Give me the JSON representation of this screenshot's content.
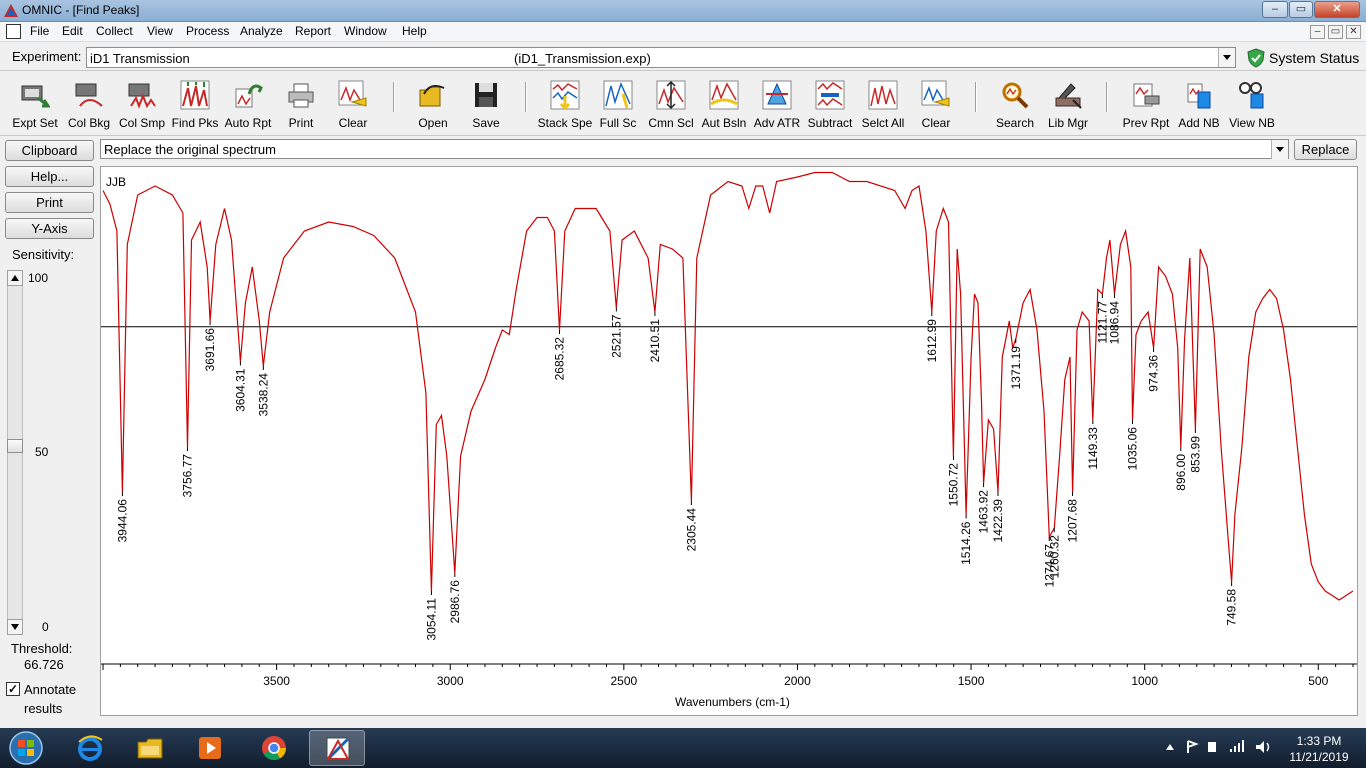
{
  "window": {
    "title": "OMNIC - [Find Peaks]",
    "minimize": "–",
    "maximize": "▭",
    "close": "✕"
  },
  "menu": [
    "File",
    "Edit",
    "Collect",
    "View",
    "Process",
    "Analyze",
    "Report",
    "Window",
    "Help"
  ],
  "experiment": {
    "label": "Experiment:",
    "value": "iD1 Transmission",
    "file": "(iD1_Transmission.exp)"
  },
  "system_status": "System Status",
  "toolbar": [
    {
      "label": "Expt Set",
      "icon": "expt-set-icon"
    },
    {
      "label": "Col Bkg",
      "icon": "collect-background-icon"
    },
    {
      "label": "Col Smp",
      "icon": "collect-sample-icon"
    },
    {
      "label": "Find Pks",
      "icon": "find-peaks-icon"
    },
    {
      "label": "Auto Rpt",
      "icon": "auto-report-icon"
    },
    {
      "label": "Print",
      "icon": "printer-icon"
    },
    {
      "label": "Clear",
      "icon": "clear-icon"
    },
    {
      "label": "Open",
      "icon": "open-folder-icon"
    },
    {
      "label": "Save",
      "icon": "floppy-disk-icon"
    },
    {
      "label": "Stack Spe",
      "icon": "stack-spectra-icon"
    },
    {
      "label": "Full Sc",
      "icon": "full-scale-icon"
    },
    {
      "label": "Cmn Scl",
      "icon": "common-scale-icon"
    },
    {
      "label": "Aut Bsln",
      "icon": "auto-baseline-icon"
    },
    {
      "label": "Adv ATR",
      "icon": "advanced-atr-icon"
    },
    {
      "label": "Subtract",
      "icon": "subtract-icon"
    },
    {
      "label": "Selct All",
      "icon": "select-all-icon"
    },
    {
      "label": "Clear",
      "icon": "clear-icon"
    },
    {
      "label": "Search",
      "icon": "magnifier-search-icon"
    },
    {
      "label": "Lib Mgr",
      "icon": "library-manager-icon"
    },
    {
      "label": "Prev Rpt",
      "icon": "preview-report-icon"
    },
    {
      "label": "Add NB",
      "icon": "add-notebook-icon"
    },
    {
      "label": "View NB",
      "icon": "view-notebook-icon"
    }
  ],
  "command": {
    "value": "Replace the original spectrum",
    "replace": "Replace"
  },
  "side": {
    "buttons": [
      "Clipboard",
      "Help...",
      "Print",
      "Y-Axis"
    ],
    "sensitivity_label": "Sensitivity:",
    "sensitivity_ticks": [
      "100",
      "50",
      "0"
    ],
    "sensitivity_value": 50,
    "threshold_label": "Threshold:",
    "threshold_value": "66.726",
    "annotate_checked": true,
    "annotate_line1": "Annotate",
    "annotate_line2": "results"
  },
  "chart_data": {
    "type": "line",
    "spectrum_label": "JJB",
    "xlabel": "Wavenumbers (cm-1)",
    "xlim": [
      4000,
      400
    ],
    "xticks": [
      3500,
      3000,
      2500,
      2000,
      1500,
      1000,
      500
    ],
    "threshold_percent": 66.726,
    "series": [
      {
        "color": "#cc0000",
        "points": [
          [
            4000,
            97
          ],
          [
            3980,
            94
          ],
          [
            3960,
            88
          ],
          [
            3944.06,
            30
          ],
          [
            3930,
            85
          ],
          [
            3900,
            96
          ],
          [
            3850,
            98
          ],
          [
            3800,
            96
          ],
          [
            3770,
            92
          ],
          [
            3756.77,
            40
          ],
          [
            3745,
            86
          ],
          [
            3720,
            90
          ],
          [
            3700,
            80
          ],
          [
            3691.66,
            68
          ],
          [
            3675,
            85
          ],
          [
            3650,
            93
          ],
          [
            3630,
            86
          ],
          [
            3604.31,
            59
          ],
          [
            3590,
            72
          ],
          [
            3570,
            80
          ],
          [
            3550,
            68
          ],
          [
            3538.24,
            58
          ],
          [
            3520,
            70
          ],
          [
            3480,
            82
          ],
          [
            3420,
            88
          ],
          [
            3350,
            90
          ],
          [
            3280,
            89
          ],
          [
            3220,
            87
          ],
          [
            3160,
            82
          ],
          [
            3100,
            70
          ],
          [
            3070,
            52
          ],
          [
            3054.11,
            8
          ],
          [
            3040,
            45
          ],
          [
            3025,
            47
          ],
          [
            3010,
            38
          ],
          [
            2986.76,
            12
          ],
          [
            2970,
            38
          ],
          [
            2940,
            48
          ],
          [
            2900,
            55
          ],
          [
            2870,
            62
          ],
          [
            2850,
            66
          ],
          [
            2830,
            65
          ],
          [
            2810,
            75
          ],
          [
            2780,
            88
          ],
          [
            2750,
            91
          ],
          [
            2720,
            91
          ],
          [
            2700,
            88
          ],
          [
            2685.32,
            66
          ],
          [
            2670,
            88
          ],
          [
            2640,
            93
          ],
          [
            2580,
            93
          ],
          [
            2540,
            88
          ],
          [
            2521.57,
            71
          ],
          [
            2505,
            86
          ],
          [
            2470,
            88
          ],
          [
            2430,
            82
          ],
          [
            2410.51,
            70
          ],
          [
            2395,
            85
          ],
          [
            2360,
            84
          ],
          [
            2330,
            82
          ],
          [
            2305.44,
            28
          ],
          [
            2290,
            82
          ],
          [
            2250,
            96
          ],
          [
            2200,
            99
          ],
          [
            2160,
            98
          ],
          [
            2140,
            93
          ],
          [
            2120,
            98
          ],
          [
            2100,
            98
          ],
          [
            2080,
            92
          ],
          [
            2060,
            99
          ],
          [
            2000,
            100
          ],
          [
            1950,
            101
          ],
          [
            1900,
            101
          ],
          [
            1850,
            99
          ],
          [
            1800,
            99
          ],
          [
            1720,
            97
          ],
          [
            1690,
            93
          ],
          [
            1670,
            97
          ],
          [
            1650,
            98
          ],
          [
            1630,
            88
          ],
          [
            1612.99,
            70
          ],
          [
            1600,
            88
          ],
          [
            1580,
            93
          ],
          [
            1565,
            90
          ],
          [
            1550.72,
            38
          ],
          [
            1540,
            84
          ],
          [
            1530,
            74
          ],
          [
            1514.26,
            25
          ],
          [
            1500,
            60
          ],
          [
            1490,
            74
          ],
          [
            1480,
            72
          ],
          [
            1470,
            50
          ],
          [
            1463.92,
            32
          ],
          [
            1450,
            46
          ],
          [
            1435,
            44
          ],
          [
            1422.39,
            30
          ],
          [
            1410,
            60
          ],
          [
            1390,
            68
          ],
          [
            1380,
            62
          ],
          [
            1371.19,
            64
          ],
          [
            1350,
            72
          ],
          [
            1330,
            75
          ],
          [
            1310,
            66
          ],
          [
            1290,
            48
          ],
          [
            1274.67,
            20
          ],
          [
            1260.32,
            22
          ],
          [
            1245,
            38
          ],
          [
            1230,
            55
          ],
          [
            1215,
            60
          ],
          [
            1207.68,
            30
          ],
          [
            1195,
            66
          ],
          [
            1180,
            70
          ],
          [
            1160,
            68
          ],
          [
            1149.33,
            46
          ],
          [
            1135,
            75
          ],
          [
            1121.77,
            74
          ],
          [
            1110,
            82
          ],
          [
            1100,
            86
          ],
          [
            1086.94,
            74
          ],
          [
            1070,
            85
          ],
          [
            1055,
            88
          ],
          [
            1040,
            80
          ],
          [
            1035.06,
            46
          ],
          [
            1025,
            65
          ],
          [
            1010,
            68
          ],
          [
            990,
            70
          ],
          [
            974.36,
            62
          ],
          [
            960,
            80
          ],
          [
            940,
            78
          ],
          [
            920,
            74
          ],
          [
            905,
            62
          ],
          [
            896.0,
            40
          ],
          [
            885,
            64
          ],
          [
            870,
            82
          ],
          [
            853.99,
            44
          ],
          [
            840,
            84
          ],
          [
            820,
            80
          ],
          [
            800,
            65
          ],
          [
            780,
            40
          ],
          [
            760,
            20
          ],
          [
            749.58,
            10
          ],
          [
            740,
            25
          ],
          [
            720,
            40
          ],
          [
            700,
            60
          ],
          [
            680,
            70
          ],
          [
            660,
            73
          ],
          [
            640,
            75
          ],
          [
            620,
            73
          ],
          [
            600,
            66
          ],
          [
            580,
            55
          ],
          [
            560,
            40
          ],
          [
            540,
            25
          ],
          [
            520,
            14
          ],
          [
            500,
            10
          ],
          [
            480,
            8
          ],
          [
            460,
            7
          ],
          [
            440,
            6
          ],
          [
            420,
            7
          ],
          [
            400,
            8
          ]
        ]
      }
    ],
    "peaks": [
      {
        "x": 3944.06,
        "label": "3944.06"
      },
      {
        "x": 3756.77,
        "label": "3756.77"
      },
      {
        "x": 3691.66,
        "label": "3691.66"
      },
      {
        "x": 3604.31,
        "label": "3604.31"
      },
      {
        "x": 3538.24,
        "label": "3538.24"
      },
      {
        "x": 3054.11,
        "label": "3054.11"
      },
      {
        "x": 2986.76,
        "label": "2986.76"
      },
      {
        "x": 2685.32,
        "label": "2685.32"
      },
      {
        "x": 2521.57,
        "label": "2521.57"
      },
      {
        "x": 2410.51,
        "label": "2410.51"
      },
      {
        "x": 2305.44,
        "label": "2305.44"
      },
      {
        "x": 1612.99,
        "label": "1612.99"
      },
      {
        "x": 1550.72,
        "label": "1550.72"
      },
      {
        "x": 1514.26,
        "label": "1514.26"
      },
      {
        "x": 1463.92,
        "label": "1463.92"
      },
      {
        "x": 1422.39,
        "label": "1422.39"
      },
      {
        "x": 1371.19,
        "label": "1371.19"
      },
      {
        "x": 1274.67,
        "label": "1274.67"
      },
      {
        "x": 1260.32,
        "label": "1260.32"
      },
      {
        "x": 1207.68,
        "label": "1207.68"
      },
      {
        "x": 1149.33,
        "label": "1149.33"
      },
      {
        "x": 1121.77,
        "label": "1121.77"
      },
      {
        "x": 1086.94,
        "label": "1086.94"
      },
      {
        "x": 1035.06,
        "label": "1035.06"
      },
      {
        "x": 974.36,
        "label": "974.36"
      },
      {
        "x": 896.0,
        "label": "896.00"
      },
      {
        "x": 853.99,
        "label": "853.99"
      },
      {
        "x": 749.58,
        "label": "749.58"
      }
    ]
  },
  "taskbar": {
    "apps": [
      "windows-start-icon",
      "internet-explorer-icon",
      "file-explorer-icon",
      "media-player-icon",
      "chrome-icon",
      "omnic-icon"
    ],
    "time": "1:33 PM",
    "date": "11/21/2019"
  }
}
